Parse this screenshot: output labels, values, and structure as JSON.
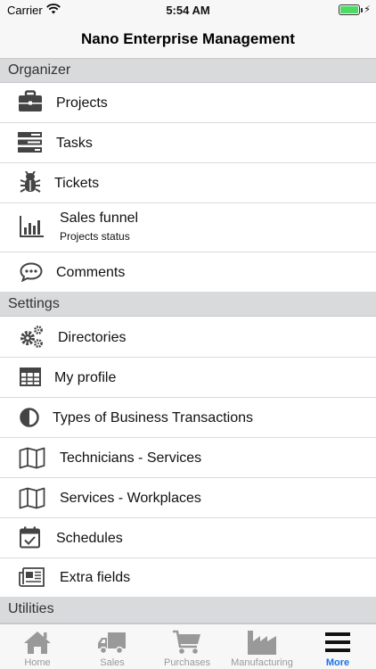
{
  "status_bar": {
    "carrier": "Carrier",
    "time": "5:54 AM"
  },
  "nav": {
    "title": "Nano Enterprise Management"
  },
  "sections": {
    "organizer": "Organizer",
    "settings": "Settings",
    "utilities": "Utilities"
  },
  "organizer_items": [
    {
      "label": "Projects",
      "icon": "briefcase-icon"
    },
    {
      "label": "Tasks",
      "icon": "tasks-icon"
    },
    {
      "label": "Tickets",
      "icon": "bug-icon"
    },
    {
      "label": "Sales funnel",
      "sublabel": "Projects status",
      "icon": "bar-chart-icon"
    },
    {
      "label": "Comments",
      "icon": "comment-icon"
    }
  ],
  "settings_items": [
    {
      "label": "Directories",
      "icon": "gears-icon"
    },
    {
      "label": "My profile",
      "icon": "table-icon"
    },
    {
      "label": "Types of Business Transactions",
      "icon": "half-circle-icon"
    },
    {
      "label": "Technicians - Services",
      "icon": "map-icon"
    },
    {
      "label": "Services - Workplaces",
      "icon": "map-icon"
    },
    {
      "label": "Schedules",
      "icon": "calendar-check-icon"
    },
    {
      "label": "Extra fields",
      "icon": "newspaper-icon"
    }
  ],
  "tab_bar": {
    "tabs": [
      {
        "label": "Home",
        "icon": "home-icon"
      },
      {
        "label": "Sales",
        "icon": "truck-icon"
      },
      {
        "label": "Purchases",
        "icon": "cart-icon"
      },
      {
        "label": "Manufacturing",
        "icon": "factory-icon"
      },
      {
        "label": "More",
        "icon": "menu-icon"
      }
    ],
    "active": "More"
  },
  "colors": {
    "section_bg": "#d9dadc",
    "icon_gray": "#444444",
    "tab_inactive": "#999999",
    "tab_active": "#1a73e8"
  }
}
